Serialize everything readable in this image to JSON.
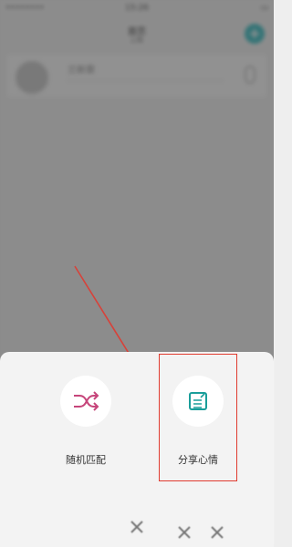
{
  "background": {
    "status_time": "15:26",
    "title": "首页",
    "subtitle": "心情",
    "conversation_name": "兰新霏"
  },
  "sheet": {
    "options": [
      {
        "label": "随机匹配",
        "icon": "shuffle-icon"
      },
      {
        "label": "分享心情",
        "icon": "note-edit-icon"
      }
    ]
  },
  "colors": {
    "accent_pink": "#c6457a",
    "accent_teal": "#1a9e9a",
    "highlight_red": "#e03b2f"
  }
}
